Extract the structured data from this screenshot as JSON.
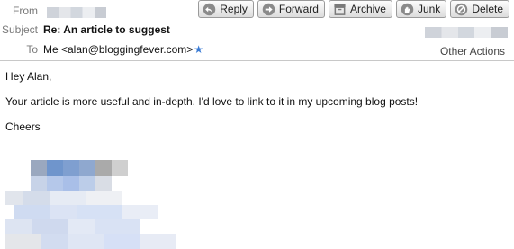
{
  "header": {
    "from_label": "From",
    "subject_label": "Subject",
    "subject": "Re: An article to suggest",
    "to_label": "To",
    "to_value": "Me <alan@bloggingfever.com>",
    "other_actions": "Other Actions"
  },
  "toolbar": {
    "reply": "Reply",
    "forward": "Forward",
    "archive": "Archive",
    "junk": "Junk",
    "delete": "Delete"
  },
  "message": {
    "greeting": "Hey Alan,",
    "body": "Your article is more useful and in-depth. I'd love to link to it in my upcoming blog posts!",
    "closing": "Cheers"
  },
  "icons": [
    "reply-icon",
    "forward-icon",
    "archive-icon",
    "junk-icon",
    "delete-icon",
    "star-icon"
  ]
}
